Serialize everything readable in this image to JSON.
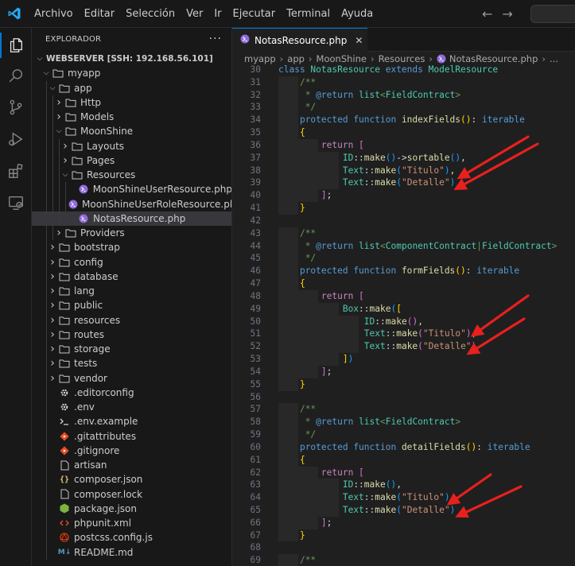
{
  "menu": [
    "Archivo",
    "Editar",
    "Selección",
    "Ver",
    "Ir",
    "Ejecutar",
    "Terminal",
    "Ayuda"
  ],
  "accent": "#0078d4",
  "sidebar": {
    "title": "EXPLORADOR",
    "root": "WEBSERVER [SSH: 192.168.56.101]",
    "items": [
      {
        "label": "myapp",
        "depth": 1,
        "kind": "folder-open"
      },
      {
        "label": "app",
        "depth": 2,
        "kind": "folder-open"
      },
      {
        "label": "Http",
        "depth": 3,
        "kind": "folder"
      },
      {
        "label": "Models",
        "depth": 3,
        "kind": "folder"
      },
      {
        "label": "MoonShine",
        "depth": 3,
        "kind": "folder-open"
      },
      {
        "label": "Layouts",
        "depth": 4,
        "kind": "folder"
      },
      {
        "label": "Pages",
        "depth": 4,
        "kind": "folder"
      },
      {
        "label": "Resources",
        "depth": 4,
        "kind": "folder-open"
      },
      {
        "label": "MoonShineUserResource.php",
        "depth": 5,
        "kind": "php"
      },
      {
        "label": "MoonShineUserRoleResource.php",
        "depth": 5,
        "kind": "php"
      },
      {
        "label": "NotasResource.php",
        "depth": 5,
        "kind": "php",
        "selected": true
      },
      {
        "label": "Providers",
        "depth": 3,
        "kind": "folder"
      },
      {
        "label": "bootstrap",
        "depth": 2,
        "kind": "folder"
      },
      {
        "label": "config",
        "depth": 2,
        "kind": "folder"
      },
      {
        "label": "database",
        "depth": 2,
        "kind": "folder"
      },
      {
        "label": "lang",
        "depth": 2,
        "kind": "folder"
      },
      {
        "label": "public",
        "depth": 2,
        "kind": "folder"
      },
      {
        "label": "resources",
        "depth": 2,
        "kind": "folder"
      },
      {
        "label": "routes",
        "depth": 2,
        "kind": "folder"
      },
      {
        "label": "storage",
        "depth": 2,
        "kind": "folder"
      },
      {
        "label": "tests",
        "depth": 2,
        "kind": "folder"
      },
      {
        "label": "vendor",
        "depth": 2,
        "kind": "folder"
      },
      {
        "label": ".editorconfig",
        "depth": 2,
        "kind": "gear"
      },
      {
        "label": ".env",
        "depth": 2,
        "kind": "gear"
      },
      {
        "label": ".env.example",
        "depth": 2,
        "kind": "terminal"
      },
      {
        "label": ".gitattributes",
        "depth": 2,
        "kind": "git"
      },
      {
        "label": ".gitignore",
        "depth": 2,
        "kind": "git"
      },
      {
        "label": "artisan",
        "depth": 2,
        "kind": "file"
      },
      {
        "label": "composer.json",
        "depth": 2,
        "kind": "json"
      },
      {
        "label": "composer.lock",
        "depth": 2,
        "kind": "file"
      },
      {
        "label": "package.json",
        "depth": 2,
        "kind": "node"
      },
      {
        "label": "phpunit.xml",
        "depth": 2,
        "kind": "xml"
      },
      {
        "label": "postcss.config.js",
        "depth": 2,
        "kind": "postcss"
      },
      {
        "label": "README.md",
        "depth": 2,
        "kind": "md"
      }
    ]
  },
  "editor": {
    "tab_label": "NotasResource.php",
    "breadcrumb": [
      "myapp",
      "app",
      "MoonShine",
      "Resources",
      "NotasResource.php",
      "..."
    ],
    "lines": [
      {
        "n": "30",
        "ind": 0,
        "tokens": [
          [
            "kw",
            "class "
          ],
          [
            "cls",
            "NotasResource "
          ],
          [
            "kw",
            "extends "
          ],
          [
            "cls",
            "ModelResource"
          ]
        ]
      },
      {
        "n": "31",
        "ind": 1,
        "tokens": [
          [
            "com",
            "/**"
          ]
        ]
      },
      {
        "n": "32",
        "ind": 1,
        "tokens": [
          [
            "com",
            " * "
          ],
          [
            "kw",
            "@return "
          ],
          [
            "cls",
            "list"
          ],
          [
            "com",
            "<"
          ],
          [
            "cls",
            "FieldContract"
          ],
          [
            "com",
            ">"
          ]
        ]
      },
      {
        "n": "33",
        "ind": 1,
        "tokens": [
          [
            "com",
            " */"
          ]
        ]
      },
      {
        "n": "34",
        "ind": 1,
        "tokens": [
          [
            "kw",
            "protected "
          ],
          [
            "kw",
            "function "
          ],
          [
            "fn",
            "indexFields"
          ],
          [
            "y",
            "()"
          ],
          [
            "d",
            ": "
          ],
          [
            "kw",
            "iterable"
          ]
        ]
      },
      {
        "n": "35",
        "ind": 1,
        "tokens": [
          [
            "y",
            "{"
          ]
        ]
      },
      {
        "n": "36",
        "ind": 2,
        "tokens": [
          [
            "ctl",
            "return "
          ],
          [
            "p",
            "["
          ]
        ]
      },
      {
        "n": "37",
        "ind": 3,
        "tokens": [
          [
            "cls",
            "ID"
          ],
          [
            "d",
            "::"
          ],
          [
            "fn",
            "make"
          ],
          [
            "b",
            "()"
          ],
          [
            "d",
            "->"
          ],
          [
            "fn",
            "sortable"
          ],
          [
            "b",
            "()"
          ],
          [
            "d",
            ","
          ]
        ]
      },
      {
        "n": "38",
        "ind": 3,
        "tokens": [
          [
            "cls",
            "Text"
          ],
          [
            "d",
            "::"
          ],
          [
            "fn",
            "make"
          ],
          [
            "b",
            "("
          ],
          [
            "str",
            "\"Titulo\""
          ],
          [
            "b",
            ")"
          ],
          [
            "d",
            ","
          ]
        ]
      },
      {
        "n": "39",
        "ind": 3,
        "tokens": [
          [
            "cls",
            "Text"
          ],
          [
            "d",
            "::"
          ],
          [
            "fn",
            "make"
          ],
          [
            "b",
            "("
          ],
          [
            "str",
            "\"Detalle\""
          ],
          [
            "b",
            ")"
          ]
        ]
      },
      {
        "n": "40",
        "ind": 2,
        "tokens": [
          [
            "p",
            "]"
          ],
          [
            "d",
            ";"
          ]
        ]
      },
      {
        "n": "41",
        "ind": 1,
        "tokens": [
          [
            "y",
            "}"
          ]
        ]
      },
      {
        "n": "42",
        "ind": 0,
        "tokens": []
      },
      {
        "n": "43",
        "ind": 1,
        "tokens": [
          [
            "com",
            "/**"
          ]
        ]
      },
      {
        "n": "44",
        "ind": 1,
        "tokens": [
          [
            "com",
            " * "
          ],
          [
            "kw",
            "@return "
          ],
          [
            "cls",
            "list"
          ],
          [
            "com",
            "<"
          ],
          [
            "cls",
            "ComponentContract"
          ],
          [
            "com",
            "|"
          ],
          [
            "cls",
            "FieldContract"
          ],
          [
            "com",
            ">"
          ]
        ]
      },
      {
        "n": "45",
        "ind": 1,
        "tokens": [
          [
            "com",
            " */"
          ]
        ]
      },
      {
        "n": "46",
        "ind": 1,
        "tokens": [
          [
            "kw",
            "protected "
          ],
          [
            "kw",
            "function "
          ],
          [
            "fn",
            "formFields"
          ],
          [
            "y",
            "()"
          ],
          [
            "d",
            ": "
          ],
          [
            "kw",
            "iterable"
          ]
        ]
      },
      {
        "n": "47",
        "ind": 1,
        "tokens": [
          [
            "y",
            "{"
          ]
        ]
      },
      {
        "n": "48",
        "ind": 2,
        "tokens": [
          [
            "ctl",
            "return "
          ],
          [
            "p",
            "["
          ]
        ]
      },
      {
        "n": "49",
        "ind": 3,
        "tokens": [
          [
            "cls",
            "Box"
          ],
          [
            "d",
            "::"
          ],
          [
            "fn",
            "make"
          ],
          [
            "b",
            "("
          ],
          [
            "y",
            "["
          ]
        ]
      },
      {
        "n": "50",
        "ind": 4,
        "tokens": [
          [
            "cls",
            "ID"
          ],
          [
            "d",
            "::"
          ],
          [
            "fn",
            "make"
          ],
          [
            "p",
            "()"
          ],
          [
            "d",
            ","
          ]
        ]
      },
      {
        "n": "51",
        "ind": 4,
        "tokens": [
          [
            "cls",
            "Text"
          ],
          [
            "d",
            "::"
          ],
          [
            "fn",
            "make"
          ],
          [
            "p",
            "("
          ],
          [
            "str",
            "\"Titulo\""
          ],
          [
            "p",
            ")"
          ],
          [
            "d",
            ","
          ]
        ]
      },
      {
        "n": "52",
        "ind": 4,
        "tokens": [
          [
            "cls",
            "Text"
          ],
          [
            "d",
            "::"
          ],
          [
            "fn",
            "make"
          ],
          [
            "p",
            "("
          ],
          [
            "str",
            "\"Detalle\""
          ],
          [
            "p",
            ")"
          ]
        ]
      },
      {
        "n": "53",
        "ind": 3,
        "tokens": [
          [
            "y",
            "]"
          ],
          [
            "b",
            ")"
          ]
        ]
      },
      {
        "n": "54",
        "ind": 2,
        "tokens": [
          [
            "p",
            "]"
          ],
          [
            "d",
            ";"
          ]
        ]
      },
      {
        "n": "55",
        "ind": 1,
        "tokens": [
          [
            "y",
            "}"
          ]
        ]
      },
      {
        "n": "56",
        "ind": 0,
        "tokens": []
      },
      {
        "n": "57",
        "ind": 1,
        "tokens": [
          [
            "com",
            "/**"
          ]
        ]
      },
      {
        "n": "58",
        "ind": 1,
        "tokens": [
          [
            "com",
            " * "
          ],
          [
            "kw",
            "@return "
          ],
          [
            "cls",
            "list"
          ],
          [
            "com",
            "<"
          ],
          [
            "cls",
            "FieldContract"
          ],
          [
            "com",
            ">"
          ]
        ]
      },
      {
        "n": "59",
        "ind": 1,
        "tokens": [
          [
            "com",
            " */"
          ]
        ]
      },
      {
        "n": "60",
        "ind": 1,
        "tokens": [
          [
            "kw",
            "protected "
          ],
          [
            "kw",
            "function "
          ],
          [
            "fn",
            "detailFields"
          ],
          [
            "y",
            "()"
          ],
          [
            "d",
            ": "
          ],
          [
            "kw",
            "iterable"
          ]
        ]
      },
      {
        "n": "61",
        "ind": 1,
        "tokens": [
          [
            "y",
            "{"
          ]
        ]
      },
      {
        "n": "62",
        "ind": 2,
        "tokens": [
          [
            "ctl",
            "return "
          ],
          [
            "p",
            "["
          ]
        ]
      },
      {
        "n": "63",
        "ind": 3,
        "tokens": [
          [
            "cls",
            "ID"
          ],
          [
            "d",
            "::"
          ],
          [
            "fn",
            "make"
          ],
          [
            "b",
            "()"
          ],
          [
            "d",
            ","
          ]
        ]
      },
      {
        "n": "64",
        "ind": 3,
        "tokens": [
          [
            "cls",
            "Text"
          ],
          [
            "d",
            "::"
          ],
          [
            "fn",
            "make"
          ],
          [
            "b",
            "("
          ],
          [
            "str",
            "\"Titulo\""
          ],
          [
            "b",
            ")"
          ],
          [
            "d",
            ","
          ]
        ]
      },
      {
        "n": "65",
        "ind": 3,
        "tokens": [
          [
            "cls",
            "Text"
          ],
          [
            "d",
            "::"
          ],
          [
            "fn",
            "make"
          ],
          [
            "b",
            "("
          ],
          [
            "str",
            "\"Detalle\""
          ],
          [
            "b",
            ")"
          ]
        ]
      },
      {
        "n": "66",
        "ind": 2,
        "tokens": [
          [
            "p",
            "]"
          ],
          [
            "d",
            ";"
          ]
        ]
      },
      {
        "n": "67",
        "ind": 1,
        "tokens": [
          [
            "y",
            "}"
          ]
        ]
      },
      {
        "n": "68",
        "ind": 0,
        "tokens": []
      },
      {
        "n": "69",
        "ind": 1,
        "tokens": [
          [
            "com",
            "/**"
          ]
        ]
      }
    ]
  },
  "annotation_color": "#e8201e"
}
